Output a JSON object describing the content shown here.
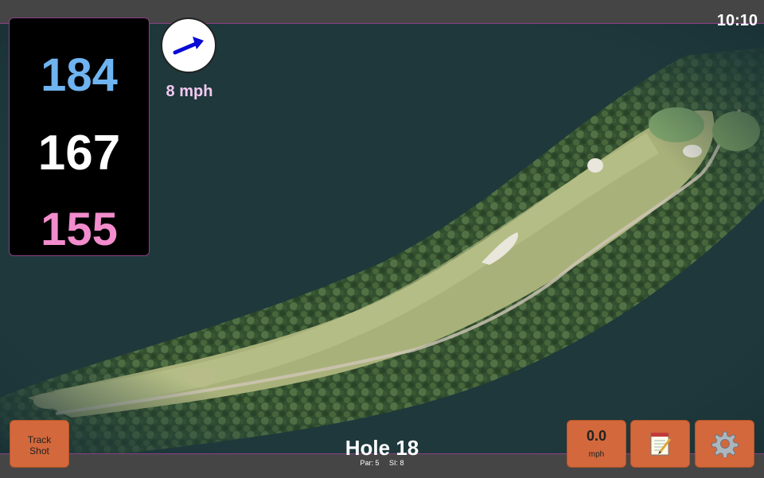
{
  "status": {
    "time": "10:10"
  },
  "distances": {
    "back": "184",
    "middle": "167",
    "front": "155"
  },
  "wind": {
    "speed_label": "8 mph",
    "direction_icon": "arrow-icon",
    "arrow_color": "#0a0ad6"
  },
  "hole": {
    "title": "Hole 18",
    "par": "Par: 5",
    "stroke_index": "SI: 8"
  },
  "buttons": {
    "track_shot_line1": "Track",
    "track_shot_line2": "Shot",
    "speed_value": "0.0",
    "speed_unit": "mph",
    "notes_icon": "notepad-icon",
    "settings_icon": "gear-icon"
  },
  "colors": {
    "back_distance": "#6fb4f1",
    "middle_distance": "#ffffff",
    "front_distance": "#f28ccd",
    "button": "#d2683c",
    "accent_border": "#8a3f87"
  }
}
